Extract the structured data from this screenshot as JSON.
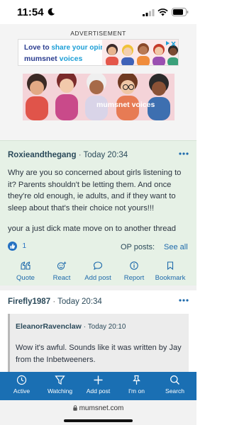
{
  "status_bar": {
    "time": "11:54",
    "icons": [
      "moon-icon",
      "signal-icon",
      "wifi-icon",
      "battery-icon"
    ]
  },
  "ad": {
    "label": "ADVERTISEMENT",
    "banner1_line1_a": "Love to ",
    "banner1_line1_b": "share your opinion?",
    "banner1_line2_a": "mumsnet",
    "banner1_line2_b": " voices",
    "banner2_text": "mumsnet voices"
  },
  "post1": {
    "author": "Roxieandthegang",
    "separator": "·",
    "time": "Today 20:34",
    "paragraph1": "Why are you so concerned about girls listening to it? Parents shouldn't be letting them. And once they're old enough, ie adults, and if they want to sleep about that's their choice not yours!!!",
    "paragraph2": "your a just dick mate move on to another thread",
    "like_count": "1",
    "op_posts_label": "OP posts:",
    "see_all": "See all",
    "actions": [
      {
        "label": "Quote",
        "icon": "quote-icon"
      },
      {
        "label": "React",
        "icon": "react-icon"
      },
      {
        "label": "Add post",
        "icon": "comment-icon"
      },
      {
        "label": "Report",
        "icon": "info-icon"
      },
      {
        "label": "Bookmark",
        "icon": "bookmark-icon"
      }
    ]
  },
  "post2": {
    "author": "Firefly1987",
    "separator": "·",
    "time": "Today 20:34",
    "quote_author": "EleanorRavenclaw",
    "quote_separator": "·",
    "quote_time": "Today 20:10",
    "quote_text": "Wow it's awful. Sounds like it was written by Jay from the Inbetweeners."
  },
  "bottom_nav": [
    {
      "label": "Active",
      "icon": "clock-icon"
    },
    {
      "label": "Watching",
      "icon": "filter-icon"
    },
    {
      "label": "Add post",
      "icon": "plus-icon"
    },
    {
      "label": "I'm on",
      "icon": "pin-icon"
    },
    {
      "label": "Search",
      "icon": "search-icon"
    }
  ],
  "browser": {
    "url": "mumsnet.com"
  },
  "colors": {
    "post_highlight_bg": "#e6f1e6",
    "link_blue": "#1e6aab",
    "nav_blue": "#1a6fb3"
  }
}
